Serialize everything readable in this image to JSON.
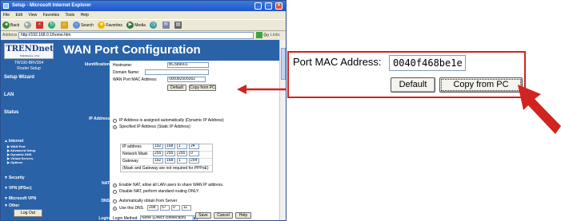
{
  "browser": {
    "title": "Setup - Microsoft Internet Explorer",
    "menu": [
      "File",
      "Edit",
      "View",
      "Favorites",
      "Tools",
      "Help"
    ],
    "toolbar": {
      "back": "Back",
      "search": "Search",
      "favorites": "Favorites",
      "media": "Media"
    },
    "address_label": "Address",
    "address": "http://192.168.0.1/home.htm",
    "go": "Go",
    "links": "Links"
  },
  "sidebar": {
    "logo": "TRENDnet",
    "logo_sub": "TRENDware, USA",
    "model": "TW100-BRV304",
    "device": "Router Setup",
    "items": [
      {
        "label": "Setup Wizard"
      },
      {
        "label": "LAN"
      },
      {
        "label": "Status"
      },
      {
        "label": "Internet"
      },
      {
        "label": "Security"
      },
      {
        "label": "VPN (IPSec)"
      },
      {
        "label": "Microsoft VPN"
      },
      {
        "label": "Other"
      }
    ],
    "subitems": [
      "WAN Port",
      "Advanced Setup",
      "Dynamic DNS",
      "Virtual Servers",
      "Options"
    ],
    "logout": "Log Out"
  },
  "page": {
    "title": "WAN Port Configuration",
    "sections": {
      "identification": "Identification",
      "ip_address": "IP Address",
      "nat": "NAT",
      "dns": "DNS",
      "login": "Login"
    },
    "identification": {
      "hostname_label": "Hostname:",
      "hostname_value": "BC589001",
      "domain_label": "Domain Name:",
      "domain_value": "",
      "mac_label": "WAN Port MAC Address:",
      "mac_value": "00c0b2505002",
      "default_button": "Default",
      "copy_button": "Copy from PC"
    },
    "ip": {
      "dynamic_label": "IP Address is assigned automatically (Dynamic IP Address)",
      "static_label": "Specified IP Address (Static IP Address)",
      "ip_label": "IP address",
      "ip": [
        "192",
        "168",
        "1",
        "24"
      ],
      "mask_label": "Network Mask",
      "mask": [
        "255",
        "255",
        "255",
        "0"
      ],
      "gateway_label": "Gateway",
      "gateway": [
        "192",
        "168",
        "1",
        "254"
      ],
      "note": "(Mask and Gateway are not required for PPPoE)"
    },
    "nat": {
      "enable_label": "Enable NAT, allow all LAN users to share WAN IP address.",
      "disable_label": "Disable NAT, perform standard routing ONLY."
    },
    "dns": {
      "auto_label": "Automatically obtain from Server",
      "use_label": "Use this DNS",
      "dns": [
        "208",
        "57",
        "0",
        "11"
      ]
    },
    "login": {
      "method_label": "Login Method:",
      "method_value": "None (Direct connection)"
    },
    "buttons": {
      "save": "Save",
      "cancel": "Cancel",
      "help": "Help"
    }
  },
  "zoom": {
    "label": "Port MAC Address:",
    "mac_value": "0040f468be1e",
    "default_button": "Default",
    "copy_button": "Copy from PC"
  },
  "colors": {
    "accent_blue": "#2a62a8",
    "callout_red": "#d1231f"
  }
}
